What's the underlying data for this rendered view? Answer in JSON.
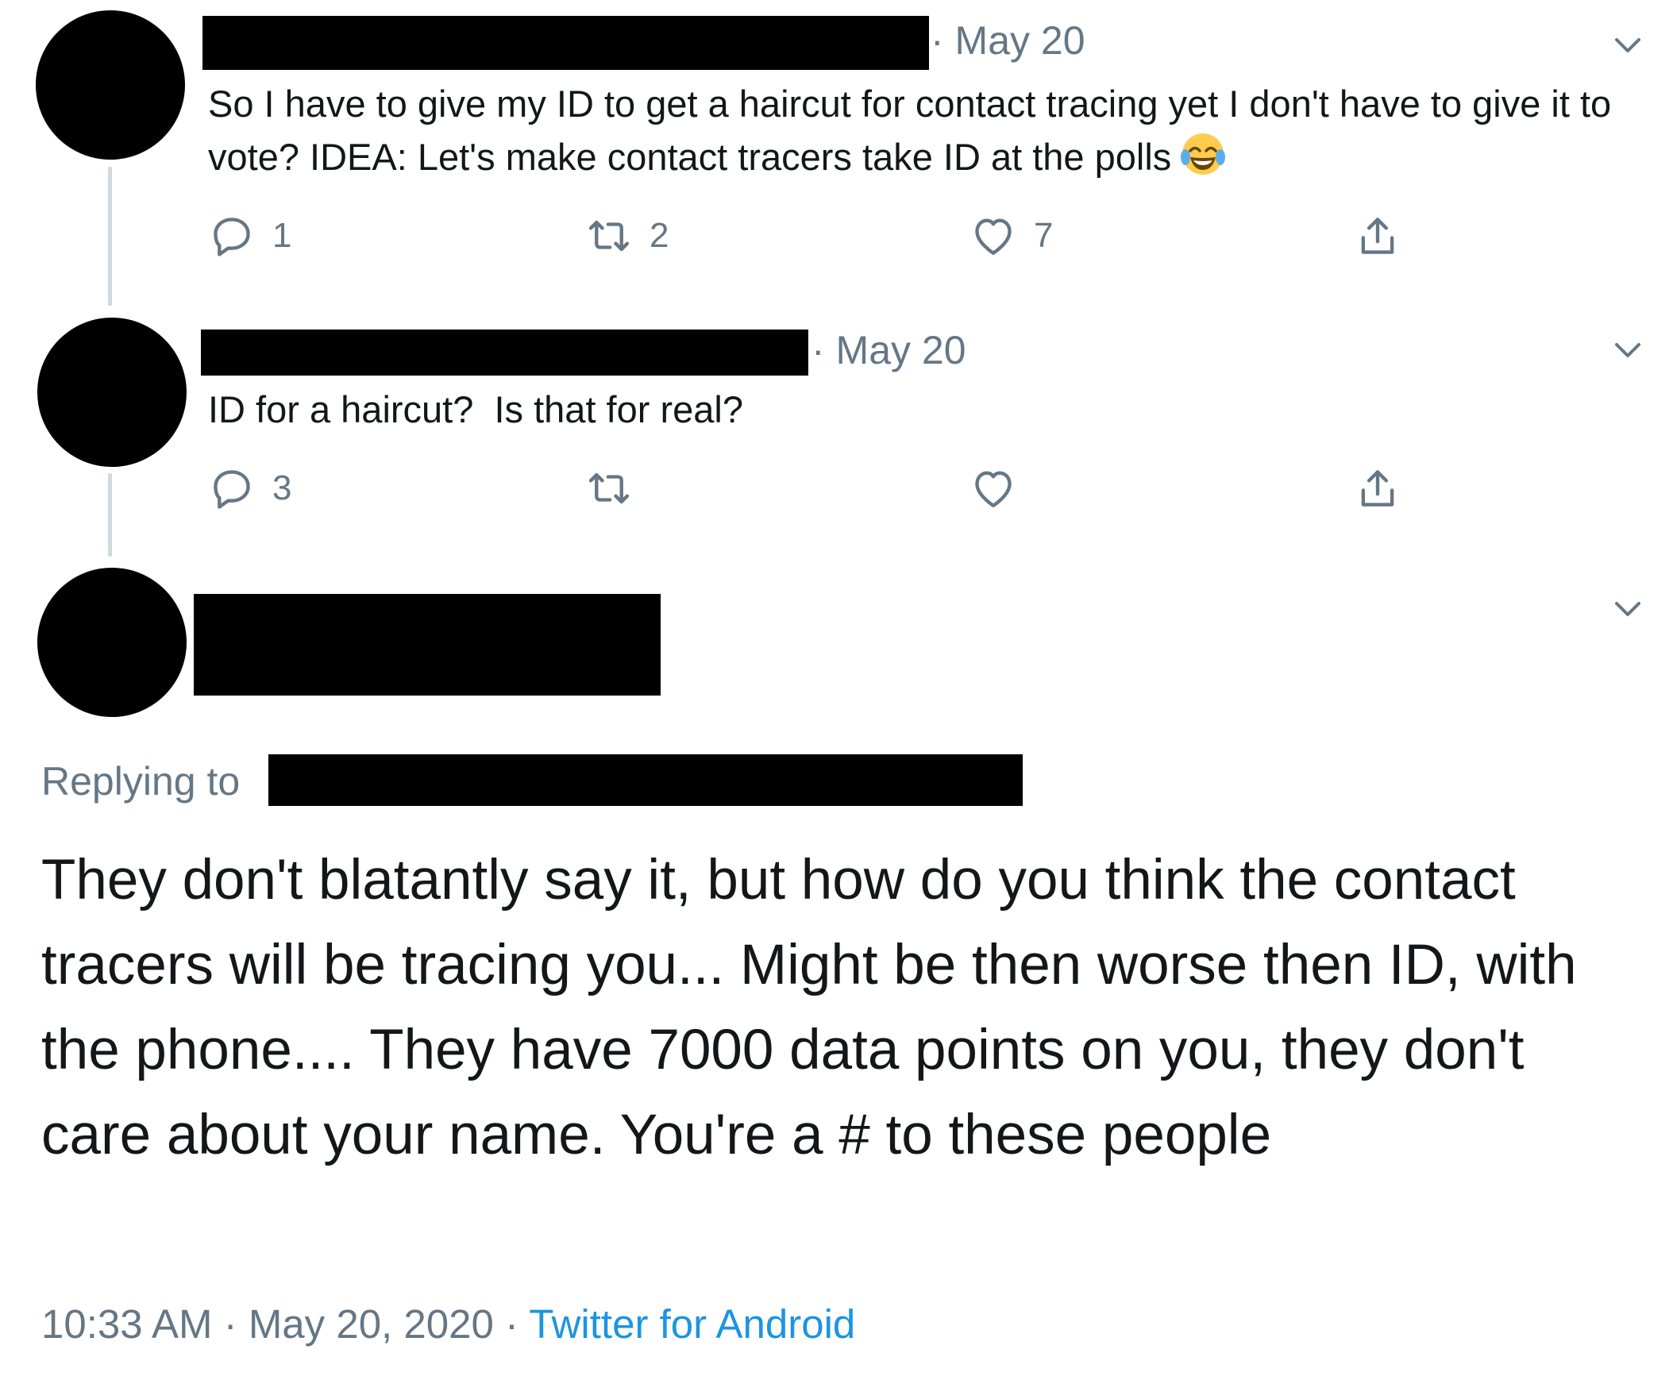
{
  "tweets": [
    {
      "date": "May 20",
      "text": "So I have to give my ID to get a haircut for contact tracing yet I don't have to give it to vote? IDEA: Let's make contact tracers take ID at the polls",
      "emoji": "face-with-tears-of-joy",
      "reply_count": "1",
      "retweet_count": "2",
      "like_count": "7"
    },
    {
      "date": "May 20",
      "text": "ID for a haircut?  Is that for real?",
      "reply_count": "3",
      "retweet_count": "",
      "like_count": ""
    }
  ],
  "main_tweet": {
    "replying_to_label": "Replying to",
    "text": "They don't blatantly say it, but how do you think the contact tracers will be tracing you... Might be then worse then ID, with the phone.... They have 7000 data points on you, they don't care about your name. You're a # to these people",
    "time": "10:33 AM",
    "date": "May 20, 2020",
    "separator": "·",
    "source": "Twitter for Android"
  },
  "colors": {
    "text": "#14171a",
    "secondary": "#657786",
    "link": "#1b95e0",
    "thread_line": "#cfd9de"
  }
}
